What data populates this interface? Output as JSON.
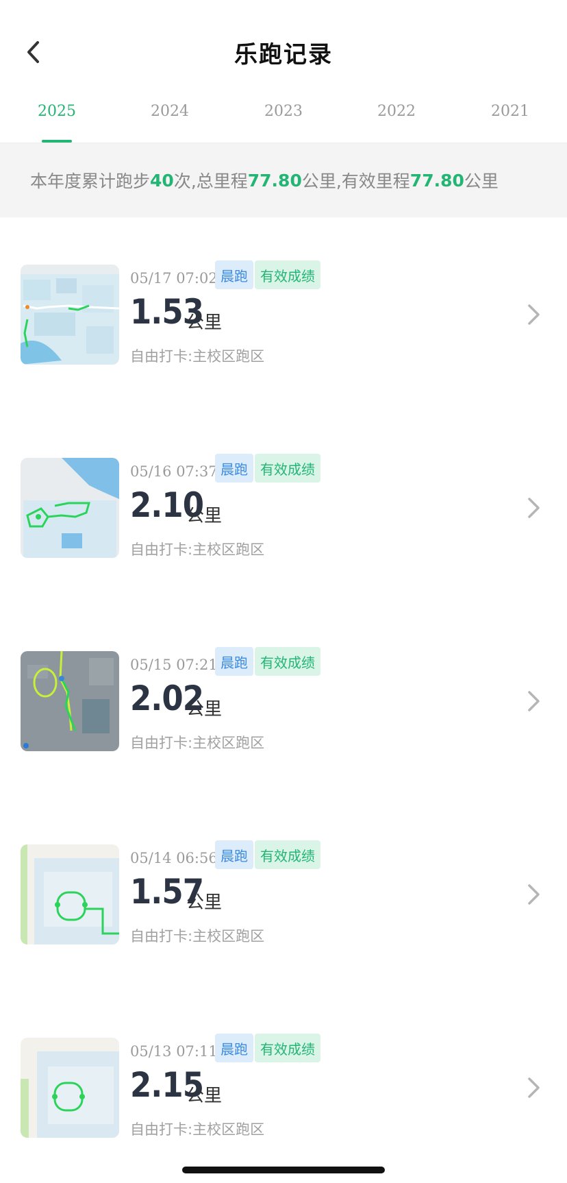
{
  "header": {
    "title": "乐跑记录"
  },
  "tabs": [
    {
      "label": "2025",
      "active": true
    },
    {
      "label": "2024",
      "active": false
    },
    {
      "label": "2023",
      "active": false
    },
    {
      "label": "2022",
      "active": false
    },
    {
      "label": "2021",
      "active": false
    }
  ],
  "summary": {
    "prefix": "本年度累计跑步",
    "count": "40",
    "count_suffix": "次,总里程",
    "total_km": "77.80",
    "total_suffix": "公里,有效里程",
    "valid_km": "77.80",
    "valid_suffix": "公里"
  },
  "records": [
    {
      "time": "05/17 07:02",
      "tag1": "晨跑",
      "tag2": "有效成绩",
      "distance": "1.53",
      "unit": "公里",
      "location": "自由打卡:主校区跑区",
      "map_style": "light"
    },
    {
      "time": "05/16 07:37",
      "tag1": "晨跑",
      "tag2": "有效成绩",
      "distance": "2.10",
      "unit": "公里",
      "location": "自由打卡:主校区跑区",
      "map_style": "light"
    },
    {
      "time": "05/15 07:21",
      "tag1": "晨跑",
      "tag2": "有效成绩",
      "distance": "2.02",
      "unit": "公里",
      "location": "自由打卡:主校区跑区",
      "map_style": "dark"
    },
    {
      "time": "05/14 06:56",
      "tag1": "晨跑",
      "tag2": "有效成绩",
      "distance": "1.57",
      "unit": "公里",
      "location": "自由打卡:主校区跑区",
      "map_style": "pale"
    },
    {
      "time": "05/13 07:11",
      "tag1": "晨跑",
      "tag2": "有效成绩",
      "distance": "2.15",
      "unit": "公里",
      "location": "自由打卡:主校区跑区",
      "map_style": "pale"
    }
  ],
  "colors": {
    "accent": "#22b573",
    "morning_badge_bg": "#dcecfb",
    "morning_badge_text": "#3c8be0",
    "valid_badge_bg": "#daf4e8"
  }
}
